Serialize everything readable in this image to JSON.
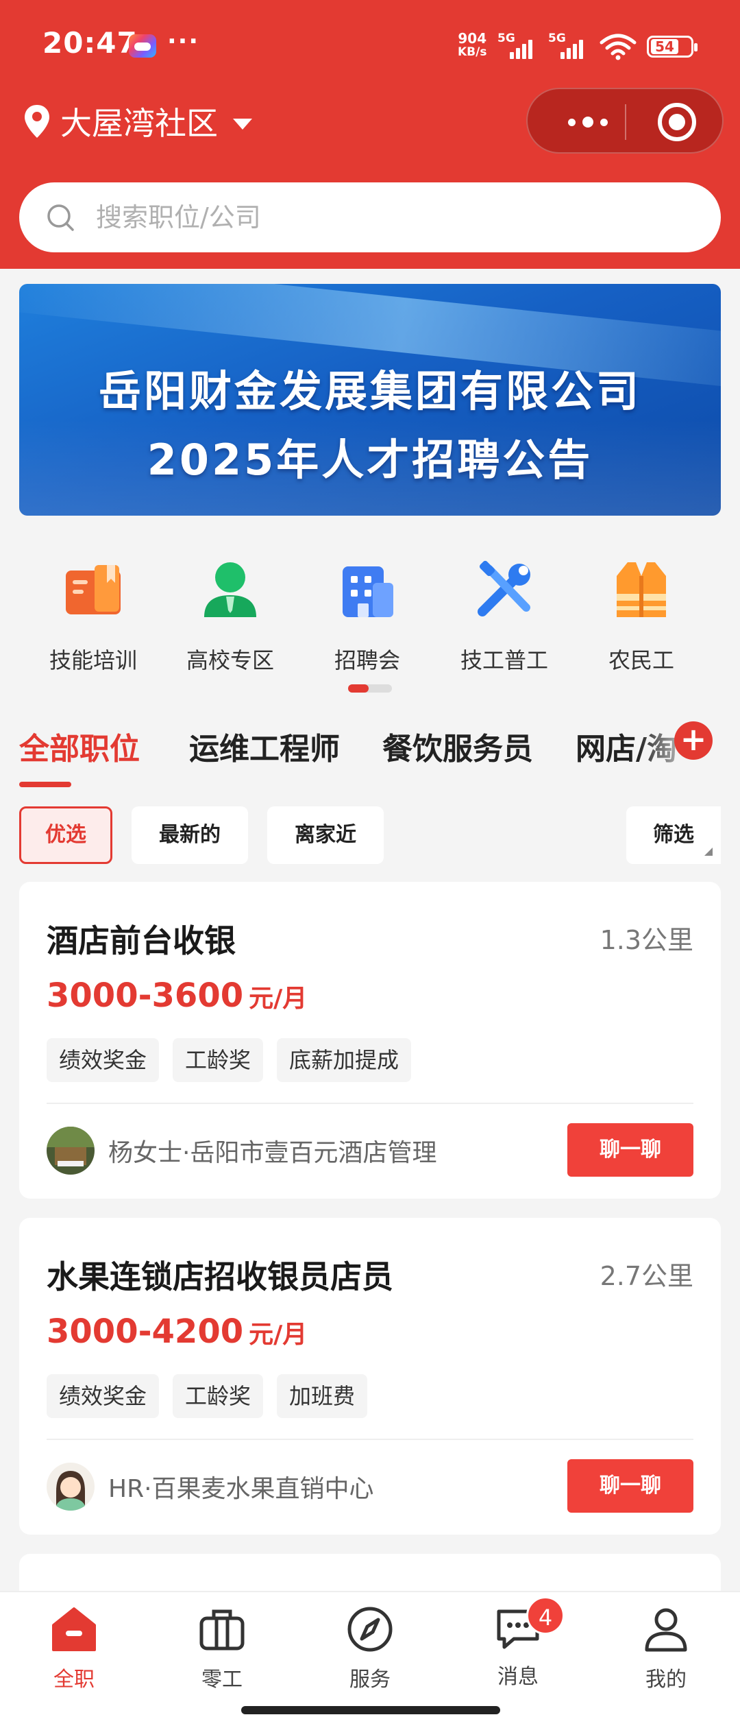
{
  "status_bar": {
    "time": "20:47",
    "dots": "···",
    "net_speed_value": "904",
    "net_speed_unit": "KB/s",
    "sim1": "5G",
    "sim2": "5G",
    "battery": "54"
  },
  "header": {
    "location": "大屋湾社区",
    "search_placeholder": "搜索职位/公司"
  },
  "banner": {
    "line1": "岳阳财金发展集团有限公司",
    "line2": "2025年人才招聘公告"
  },
  "quick_links": [
    {
      "label": "技能培训",
      "icon": "book-icon"
    },
    {
      "label": "高校专区",
      "icon": "graduate-icon"
    },
    {
      "label": "招聘会",
      "icon": "building-icon"
    },
    {
      "label": "技工普工",
      "icon": "tools-icon"
    },
    {
      "label": "农民工",
      "icon": "safety-vest-icon"
    }
  ],
  "tabs": [
    "全部职位",
    "运维工程师",
    "餐饮服务员",
    "网店/淘"
  ],
  "filters": [
    "优选",
    "最新的",
    "离家近",
    "筛选"
  ],
  "jobs": [
    {
      "title": "酒店前台收银",
      "distance": "1.3公里",
      "salary": "3000-3600",
      "salary_unit": "元/月",
      "tags": [
        "绩效奖金",
        "工龄奖",
        "底薪加提成"
      ],
      "recruiter": "杨女士·岳阳市壹百元酒店管理",
      "chat": "聊一聊"
    },
    {
      "title": "水果连锁店招收银员店员",
      "distance": "2.7公里",
      "salary": "3000-4200",
      "salary_unit": "元/月",
      "tags": [
        "绩效奖金",
        "工龄奖",
        "加班费"
      ],
      "recruiter": "HR·百果麦水果直销中心",
      "chat": "聊一聊"
    }
  ],
  "tabbar": {
    "items": [
      "全职",
      "零工",
      "服务",
      "消息",
      "我的"
    ],
    "message_badge": "4"
  },
  "colors": {
    "brand_red": "#e33a32",
    "chat_button": "#f0413a"
  }
}
